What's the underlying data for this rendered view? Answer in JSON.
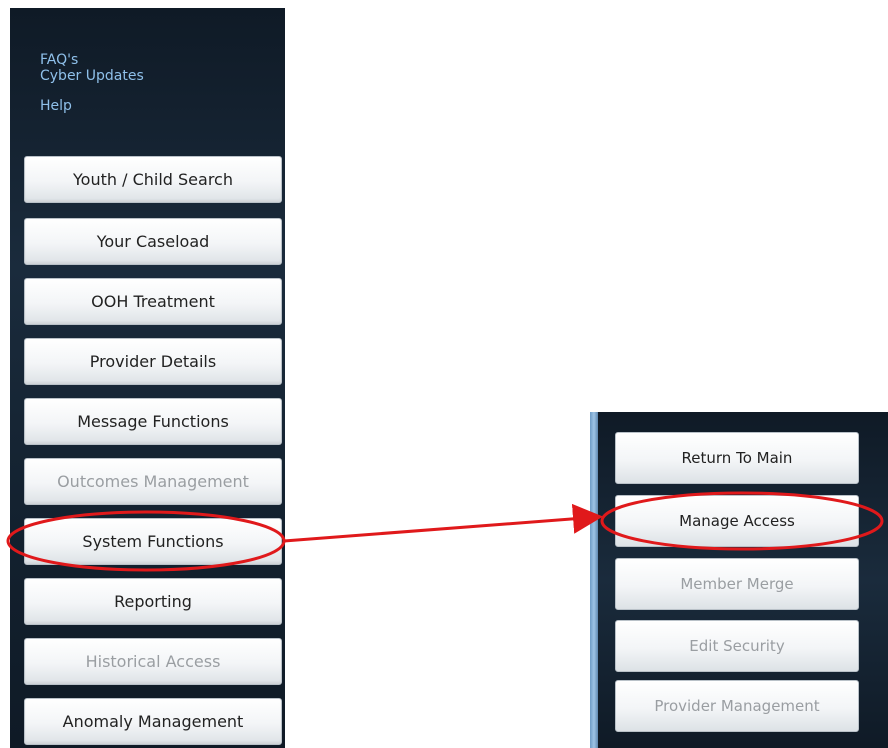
{
  "links": {
    "faq": "FAQ's",
    "cyber_updates": "Cyber Updates",
    "help": "Help"
  },
  "nav": {
    "items": [
      {
        "label": "Youth / Child Search",
        "state": "enabled"
      },
      {
        "label": "Your Caseload",
        "state": "enabled"
      },
      {
        "label": "OOH Treatment",
        "state": "enabled"
      },
      {
        "label": "Provider Details",
        "state": "enabled"
      },
      {
        "label": "Message Functions",
        "state": "enabled"
      },
      {
        "label": "Outcomes Management",
        "state": "disabled"
      },
      {
        "label": "System Functions",
        "state": "enabled",
        "highlighted": true
      },
      {
        "label": "Reporting",
        "state": "enabled"
      },
      {
        "label": "Historical Access",
        "state": "disabled"
      },
      {
        "label": "Anomaly Management",
        "state": "enabled"
      }
    ]
  },
  "submenu": {
    "items": [
      {
        "label": "Return To Main",
        "state": "enabled"
      },
      {
        "label": "Manage Access",
        "state": "enabled",
        "highlighted": true
      },
      {
        "label": "Member Merge",
        "state": "disabled"
      },
      {
        "label": "Edit Security",
        "state": "disabled"
      },
      {
        "label": "Provider Management",
        "state": "disabled"
      }
    ]
  },
  "colors": {
    "panel_dark": "#13212f",
    "link": "#8fc0ea",
    "annotation": "#e0191b",
    "disabled_text": "#9a9ea2"
  }
}
